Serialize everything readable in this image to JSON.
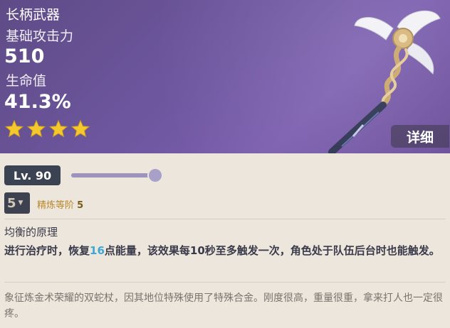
{
  "header": {
    "weapon_type": "长柄武器",
    "stat1_label": "基础攻击力",
    "stat1_value": "510",
    "stat2_label": "生命值",
    "stat2_value": "41.3%",
    "rarity_stars": 4,
    "detail_label": "详细"
  },
  "level": {
    "label": "Lv. 90",
    "progress": 1.0
  },
  "refinement": {
    "selected": "5",
    "label": "精炼等阶",
    "level": "5"
  },
  "passive": {
    "name": "均衡的原理",
    "desc_part1": "进行治疗时，恢复",
    "desc_highlight": "16",
    "desc_part2": "点能量，该效果每10秒至多触发一次，角色处于队伍后台时也能触发。"
  },
  "lore": "象征炼金术荣耀的双蛇杖，因其地位特殊使用了特殊合金。刚度很高，重量很重，拿来打人也一定很疼。",
  "colors": {
    "header_bg": "#6F57A0",
    "star": "#F5C82E",
    "highlight": "#3AA7D5",
    "panel_bg": "#ECE6DC"
  },
  "icons": {
    "star": "star-icon",
    "chevron": "chevron-down-icon"
  }
}
